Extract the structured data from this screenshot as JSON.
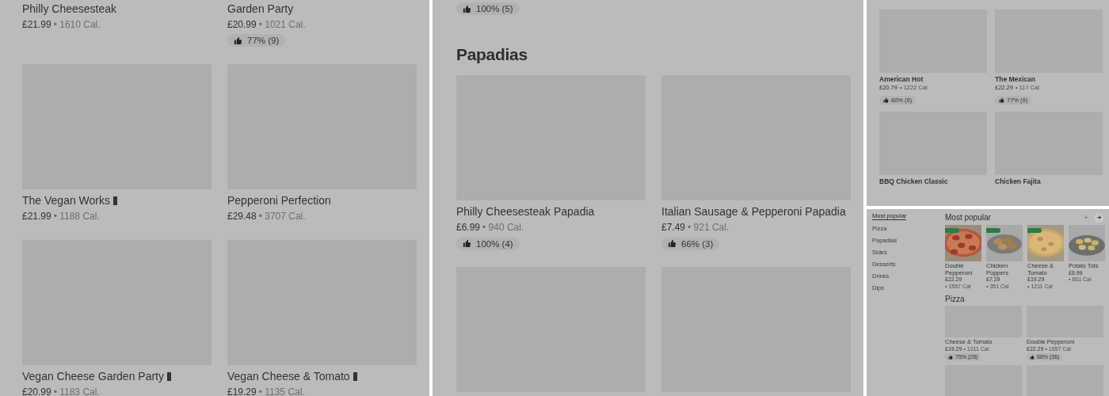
{
  "panels": [
    {
      "kind": "menu_grid",
      "sections": [
        {
          "items": [
            {
              "name": "Philly Cheesesteak",
              "price": "£21.99",
              "calories": "• 1610 Cal."
            },
            {
              "name": "Garden Party",
              "price": "£20.99",
              "calories": "• 1021 Cal.",
              "rating": "77% (9)"
            },
            {
              "image": true,
              "name": "The Vegan Works",
              "tag_icon": true,
              "price": "£21.99",
              "calories": "• 1188 Cal."
            },
            {
              "image": true,
              "name": "Pepperoni Perfection",
              "price": "£29.48",
              "calories": "• 3707 Cal."
            },
            {
              "image": true,
              "name": "Vegan Cheese Garden Party",
              "tag_icon": true,
              "price": "£20.99",
              "calories": "• 1183 Cal."
            },
            {
              "image": true,
              "name": "Vegan Cheese & Tomato",
              "tag_icon": true,
              "price": "£19.29",
              "calories": "• 1135 Cal."
            }
          ]
        }
      ]
    },
    {
      "kind": "menu_grid",
      "sections": [
        {
          "items": [
            {
              "rating": "100% (5)"
            }
          ]
        },
        {
          "heading": "Papadias",
          "items": [
            {
              "image": true,
              "name": "Philly Cheesesteak Papadia",
              "price": "£6.99",
              "calories": "• 940 Cal.",
              "rating": "100% (4)"
            },
            {
              "image": true,
              "name": "Italian Sausage & Pepperoni Papadia",
              "price": "£7.49",
              "calories": "• 921 Cal.",
              "rating": "66% (3)"
            },
            {
              "image": true
            },
            {
              "image": true
            }
          ]
        }
      ]
    },
    {
      "kind": "compact_grid",
      "sections": [
        {
          "items": [
            {
              "image": true,
              "name": "American Hot",
              "price": "£20.79",
              "calories": "• 1222 Cal",
              "rating": "80% (5)"
            },
            {
              "image": true,
              "name": "The Mexican",
              "price": "£22.29",
              "calories": "• 117 Cal",
              "rating": "77% (9)"
            },
            {
              "image": true,
              "name": "BBQ Chicken Classic"
            },
            {
              "image": true,
              "name": "Chicken Fajita"
            }
          ]
        }
      ]
    },
    {
      "kind": "store_page",
      "sidebar": [
        {
          "label": "Most popular",
          "selected": true
        },
        {
          "label": "Pizza",
          "selected": false
        },
        {
          "label": "Papadias",
          "selected": false
        },
        {
          "label": "Sides",
          "selected": false
        },
        {
          "label": "Desserts",
          "selected": false
        },
        {
          "label": "Drinks",
          "selected": false
        },
        {
          "label": "Dips",
          "selected": false
        }
      ],
      "popular": {
        "heading": "Most popular",
        "arrows": [
          {
            "disabled": true
          },
          {
            "disabled": false
          }
        ],
        "items": [
          {
            "promo": true,
            "name": "Double Pepperoni",
            "price": "£22.29",
            "calories": "• 1557 Cal"
          },
          {
            "promo": true,
            "name": "Chicken Poppers",
            "price": "£7.29",
            "calories": "• 351 Cal"
          },
          {
            "promo": true,
            "name": "Cheese & Tomato",
            "price": "£19.29",
            "calories": "• 1211 Cal"
          },
          {
            "name": "Potato Tots",
            "price": "£6.99",
            "calories": "• 661 Cal"
          }
        ]
      },
      "section": {
        "heading": "Pizza",
        "items": [
          {
            "image": true,
            "name": "Cheese & Tomato",
            "price": "£19.29",
            "calories": "• 1211 Cal",
            "rating": "75% (28)"
          },
          {
            "image": true,
            "name": "Double Pepperoni",
            "price": "£22.29",
            "calories": "• 1557 Cal",
            "rating": "88% (36)"
          },
          {
            "image": true
          },
          {
            "image": true
          }
        ]
      }
    }
  ]
}
